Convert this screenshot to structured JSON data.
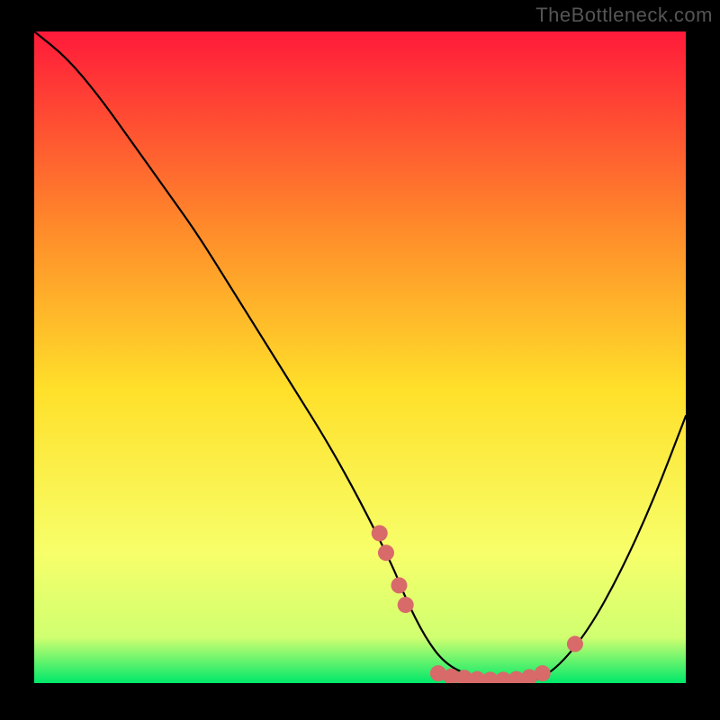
{
  "watermark": "TheBottleneck.com",
  "chart_data": {
    "type": "line",
    "title": "",
    "xlabel": "",
    "ylabel": "",
    "xlim": [
      0,
      100
    ],
    "ylim": [
      0,
      100
    ],
    "gradient_colors": {
      "top": "#ff1a3a",
      "upper_mid": "#ff8a2a",
      "mid": "#ffe02a",
      "lower_mid": "#f7ff6a",
      "near_bottom": "#d0ff70",
      "bottom": "#00e86a"
    },
    "curve": {
      "name": "bottleneck-curve",
      "x": [
        0,
        5,
        10,
        15,
        20,
        25,
        30,
        35,
        40,
        45,
        50,
        55,
        57,
        60,
        63,
        67,
        72,
        76,
        80,
        85,
        90,
        95,
        100
      ],
      "y": [
        100,
        96,
        90,
        83,
        76,
        69,
        61,
        53,
        45,
        37,
        28,
        18,
        13,
        7,
        3,
        1,
        0,
        0,
        2,
        8,
        17,
        28,
        41
      ]
    },
    "markers": {
      "name": "highlight-dots",
      "color": "#d86a6a",
      "radius": 9,
      "points": [
        {
          "x": 53,
          "y": 23
        },
        {
          "x": 54,
          "y": 20
        },
        {
          "x": 56,
          "y": 15
        },
        {
          "x": 57,
          "y": 12
        },
        {
          "x": 62,
          "y": 1.5
        },
        {
          "x": 64,
          "y": 1
        },
        {
          "x": 66,
          "y": 0.8
        },
        {
          "x": 68,
          "y": 0.6
        },
        {
          "x": 70,
          "y": 0.5
        },
        {
          "x": 72,
          "y": 0.5
        },
        {
          "x": 74,
          "y": 0.6
        },
        {
          "x": 76,
          "y": 0.9
        },
        {
          "x": 78,
          "y": 1.5
        },
        {
          "x": 83,
          "y": 6
        }
      ]
    }
  }
}
